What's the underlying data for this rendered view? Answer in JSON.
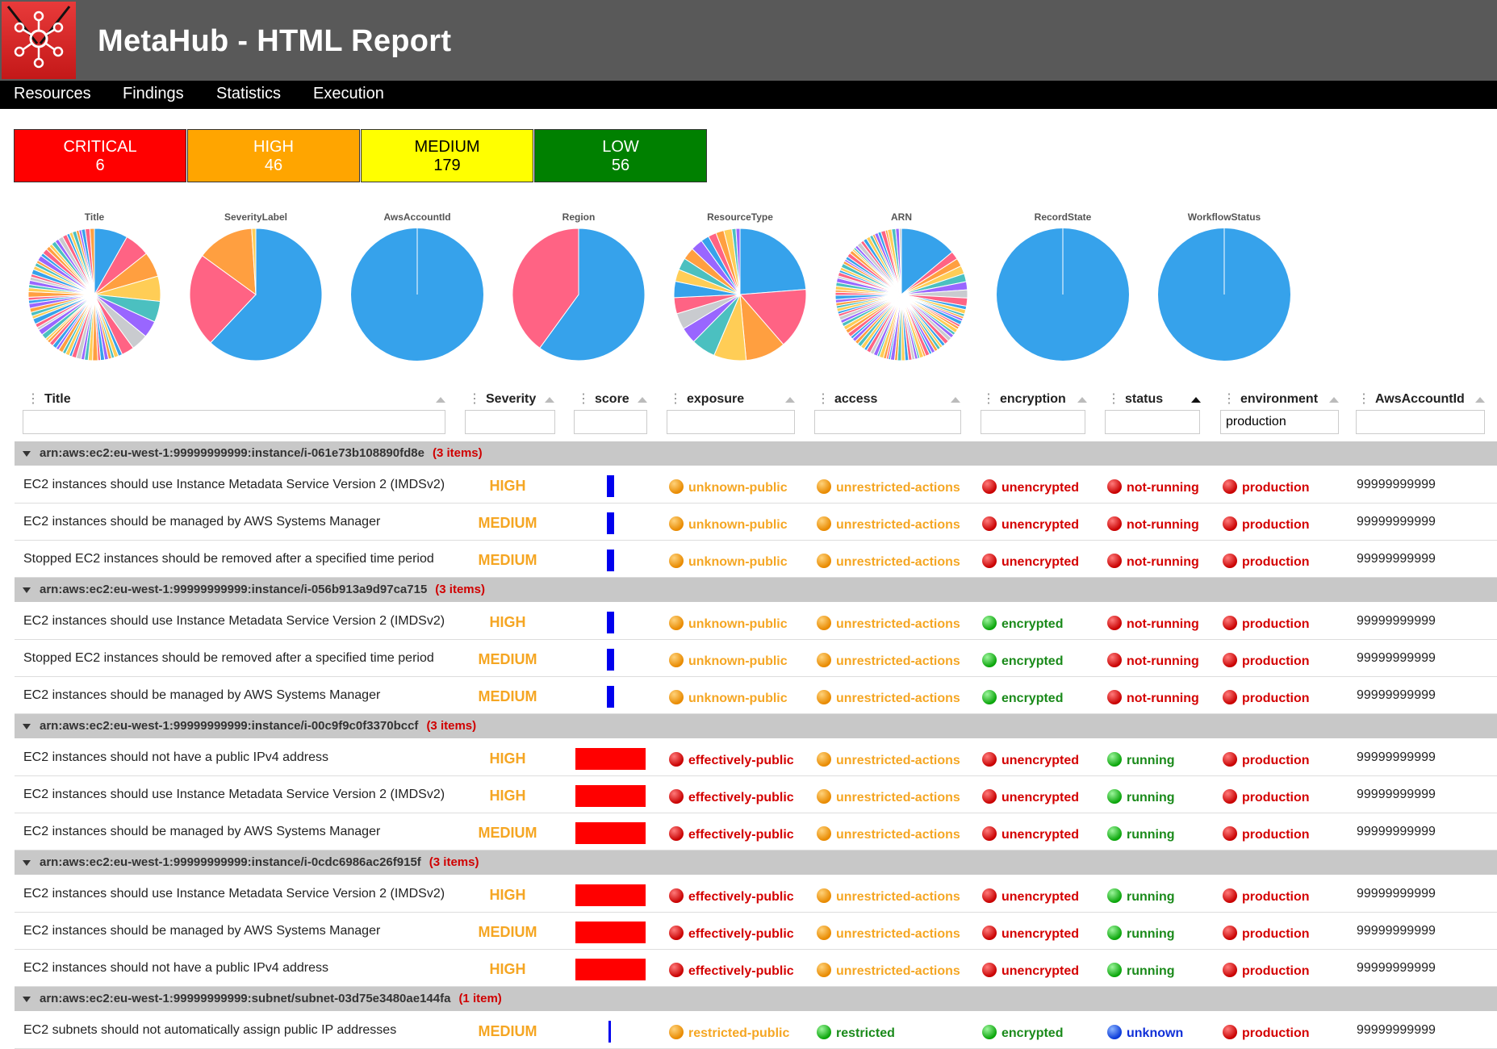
{
  "header": {
    "title": "MetaHub - HTML Report"
  },
  "nav": [
    {
      "label": "Resources"
    },
    {
      "label": "Findings"
    },
    {
      "label": "Statistics"
    },
    {
      "label": "Execution"
    }
  ],
  "severity_counts": [
    {
      "label": "CRITICAL",
      "value": "6",
      "color": "#ff0000",
      "text": "#ffffff"
    },
    {
      "label": "HIGH",
      "value": "46",
      "color": "#ffa500",
      "text": "#ffffff"
    },
    {
      "label": "MEDIUM",
      "value": "179",
      "color": "#ffff00",
      "text": "#000000"
    },
    {
      "label": "LOW",
      "value": "56",
      "color": "#008000",
      "text": "#ffffff"
    }
  ],
  "pies": [
    {
      "label": "Title"
    },
    {
      "label": "SeverityLabel"
    },
    {
      "label": "AwsAccountId"
    },
    {
      "label": "Region"
    },
    {
      "label": "ResourceType"
    },
    {
      "label": "ARN"
    },
    {
      "label": "RecordState"
    },
    {
      "label": "WorkflowStatus"
    }
  ],
  "chart_data": [
    {
      "type": "pie",
      "title": "SeverityLabel",
      "values": [
        62,
        23,
        14,
        1
      ],
      "colors": [
        "#36a2eb",
        "#ff6384",
        "#ff9f40",
        "#ffcd56"
      ]
    },
    {
      "type": "pie",
      "title": "AwsAccountId",
      "values": [
        100
      ],
      "colors": [
        "#36a2eb"
      ]
    },
    {
      "type": "pie",
      "title": "Region",
      "values": [
        60,
        40
      ],
      "colors": [
        "#36a2eb",
        "#ff6384"
      ]
    },
    {
      "type": "pie",
      "title": "RecordState",
      "values": [
        100
      ],
      "colors": [
        "#36a2eb"
      ]
    },
    {
      "type": "pie",
      "title": "WorkflowStatus",
      "values": [
        100
      ],
      "colors": [
        "#36a2eb"
      ]
    }
  ],
  "columns": [
    {
      "label": "Title",
      "sort": "dim"
    },
    {
      "label": "Severity",
      "sort": "dim"
    },
    {
      "label": "score",
      "sort": "dim"
    },
    {
      "label": "exposure",
      "sort": "dim"
    },
    {
      "label": "access",
      "sort": "dim"
    },
    {
      "label": "encryption",
      "sort": "dim"
    },
    {
      "label": "status",
      "sort": "active"
    },
    {
      "label": "environment",
      "sort": "dim"
    },
    {
      "label": "AwsAccountId",
      "sort": "dim"
    }
  ],
  "filters": {
    "environment": "production"
  },
  "groups": [
    {
      "arn": "arn:aws:ec2:eu-west-1:99999999999:instance/i-061e73b108890fd8e",
      "count": "(3 items)",
      "rows": [
        {
          "title": "EC2 instances should use Instance Metadata Service Version 2 (IMDSv2)",
          "severity": "HIGH",
          "score": "low",
          "exposure": "unknown-public",
          "access": "unrestricted-actions",
          "encryption": "unencrypted",
          "status": "not-running",
          "environment": "production",
          "account": "99999999999"
        },
        {
          "title": "EC2 instances should be managed by AWS Systems Manager",
          "severity": "MEDIUM",
          "score": "low",
          "exposure": "unknown-public",
          "access": "unrestricted-actions",
          "encryption": "unencrypted",
          "status": "not-running",
          "environment": "production",
          "account": "99999999999"
        },
        {
          "title": "Stopped EC2 instances should be removed after a specified time period",
          "severity": "MEDIUM",
          "score": "low",
          "exposure": "unknown-public",
          "access": "unrestricted-actions",
          "encryption": "unencrypted",
          "status": "not-running",
          "environment": "production",
          "account": "99999999999"
        }
      ]
    },
    {
      "arn": "arn:aws:ec2:eu-west-1:99999999999:instance/i-056b913a9d97ca715",
      "count": "(3 items)",
      "rows": [
        {
          "title": "EC2 instances should use Instance Metadata Service Version 2 (IMDSv2)",
          "severity": "HIGH",
          "score": "low",
          "exposure": "unknown-public",
          "access": "unrestricted-actions",
          "encryption": "encrypted",
          "status": "not-running",
          "environment": "production",
          "account": "99999999999"
        },
        {
          "title": "Stopped EC2 instances should be removed after a specified time period",
          "severity": "MEDIUM",
          "score": "low",
          "exposure": "unknown-public",
          "access": "unrestricted-actions",
          "encryption": "encrypted",
          "status": "not-running",
          "environment": "production",
          "account": "99999999999"
        },
        {
          "title": "EC2 instances should be managed by AWS Systems Manager",
          "severity": "MEDIUM",
          "score": "low",
          "exposure": "unknown-public",
          "access": "unrestricted-actions",
          "encryption": "encrypted",
          "status": "not-running",
          "environment": "production",
          "account": "99999999999"
        }
      ]
    },
    {
      "arn": "arn:aws:ec2:eu-west-1:99999999999:instance/i-00c9f9c0f3370bccf",
      "count": "(3 items)",
      "rows": [
        {
          "title": "EC2 instances should not have a public IPv4 address",
          "severity": "HIGH",
          "score": "high",
          "exposure": "effectively-public",
          "access": "unrestricted-actions",
          "encryption": "unencrypted",
          "status": "running",
          "environment": "production",
          "account": "99999999999"
        },
        {
          "title": "EC2 instances should use Instance Metadata Service Version 2 (IMDSv2)",
          "severity": "HIGH",
          "score": "high",
          "exposure": "effectively-public",
          "access": "unrestricted-actions",
          "encryption": "unencrypted",
          "status": "running",
          "environment": "production",
          "account": "99999999999"
        },
        {
          "title": "EC2 instances should be managed by AWS Systems Manager",
          "severity": "MEDIUM",
          "score": "high",
          "exposure": "effectively-public",
          "access": "unrestricted-actions",
          "encryption": "unencrypted",
          "status": "running",
          "environment": "production",
          "account": "99999999999"
        }
      ]
    },
    {
      "arn": "arn:aws:ec2:eu-west-1:99999999999:instance/i-0cdc6986ac26f915f",
      "count": "(3 items)",
      "rows": [
        {
          "title": "EC2 instances should use Instance Metadata Service Version 2 (IMDSv2)",
          "severity": "HIGH",
          "score": "high",
          "exposure": "effectively-public",
          "access": "unrestricted-actions",
          "encryption": "unencrypted",
          "status": "running",
          "environment": "production",
          "account": "99999999999"
        },
        {
          "title": "EC2 instances should be managed by AWS Systems Manager",
          "severity": "MEDIUM",
          "score": "high",
          "exposure": "effectively-public",
          "access": "unrestricted-actions",
          "encryption": "unencrypted",
          "status": "running",
          "environment": "production",
          "account": "99999999999"
        },
        {
          "title": "EC2 instances should not have a public IPv4 address",
          "severity": "HIGH",
          "score": "high",
          "exposure": "effectively-public",
          "access": "unrestricted-actions",
          "encryption": "unencrypted",
          "status": "running",
          "environment": "production",
          "account": "99999999999"
        }
      ]
    },
    {
      "arn": "arn:aws:ec2:eu-west-1:99999999999:subnet/subnet-03d75e3480ae144fa",
      "count": "(1 item)",
      "rows": [
        {
          "title": "EC2 subnets should not automatically assign public IP addresses",
          "severity": "MEDIUM",
          "score": "minimal",
          "exposure": "restricted-public",
          "access": "restricted",
          "encryption": "encrypted",
          "status": "unknown",
          "environment": "production",
          "account": "99999999999"
        }
      ]
    }
  ],
  "colors": {
    "topbar": "#595959",
    "nav": "#000000",
    "group": "#c8c8c8",
    "severity_text": "#f5a623",
    "score_blue": "#0000ee",
    "score_red": "#ff0000"
  }
}
